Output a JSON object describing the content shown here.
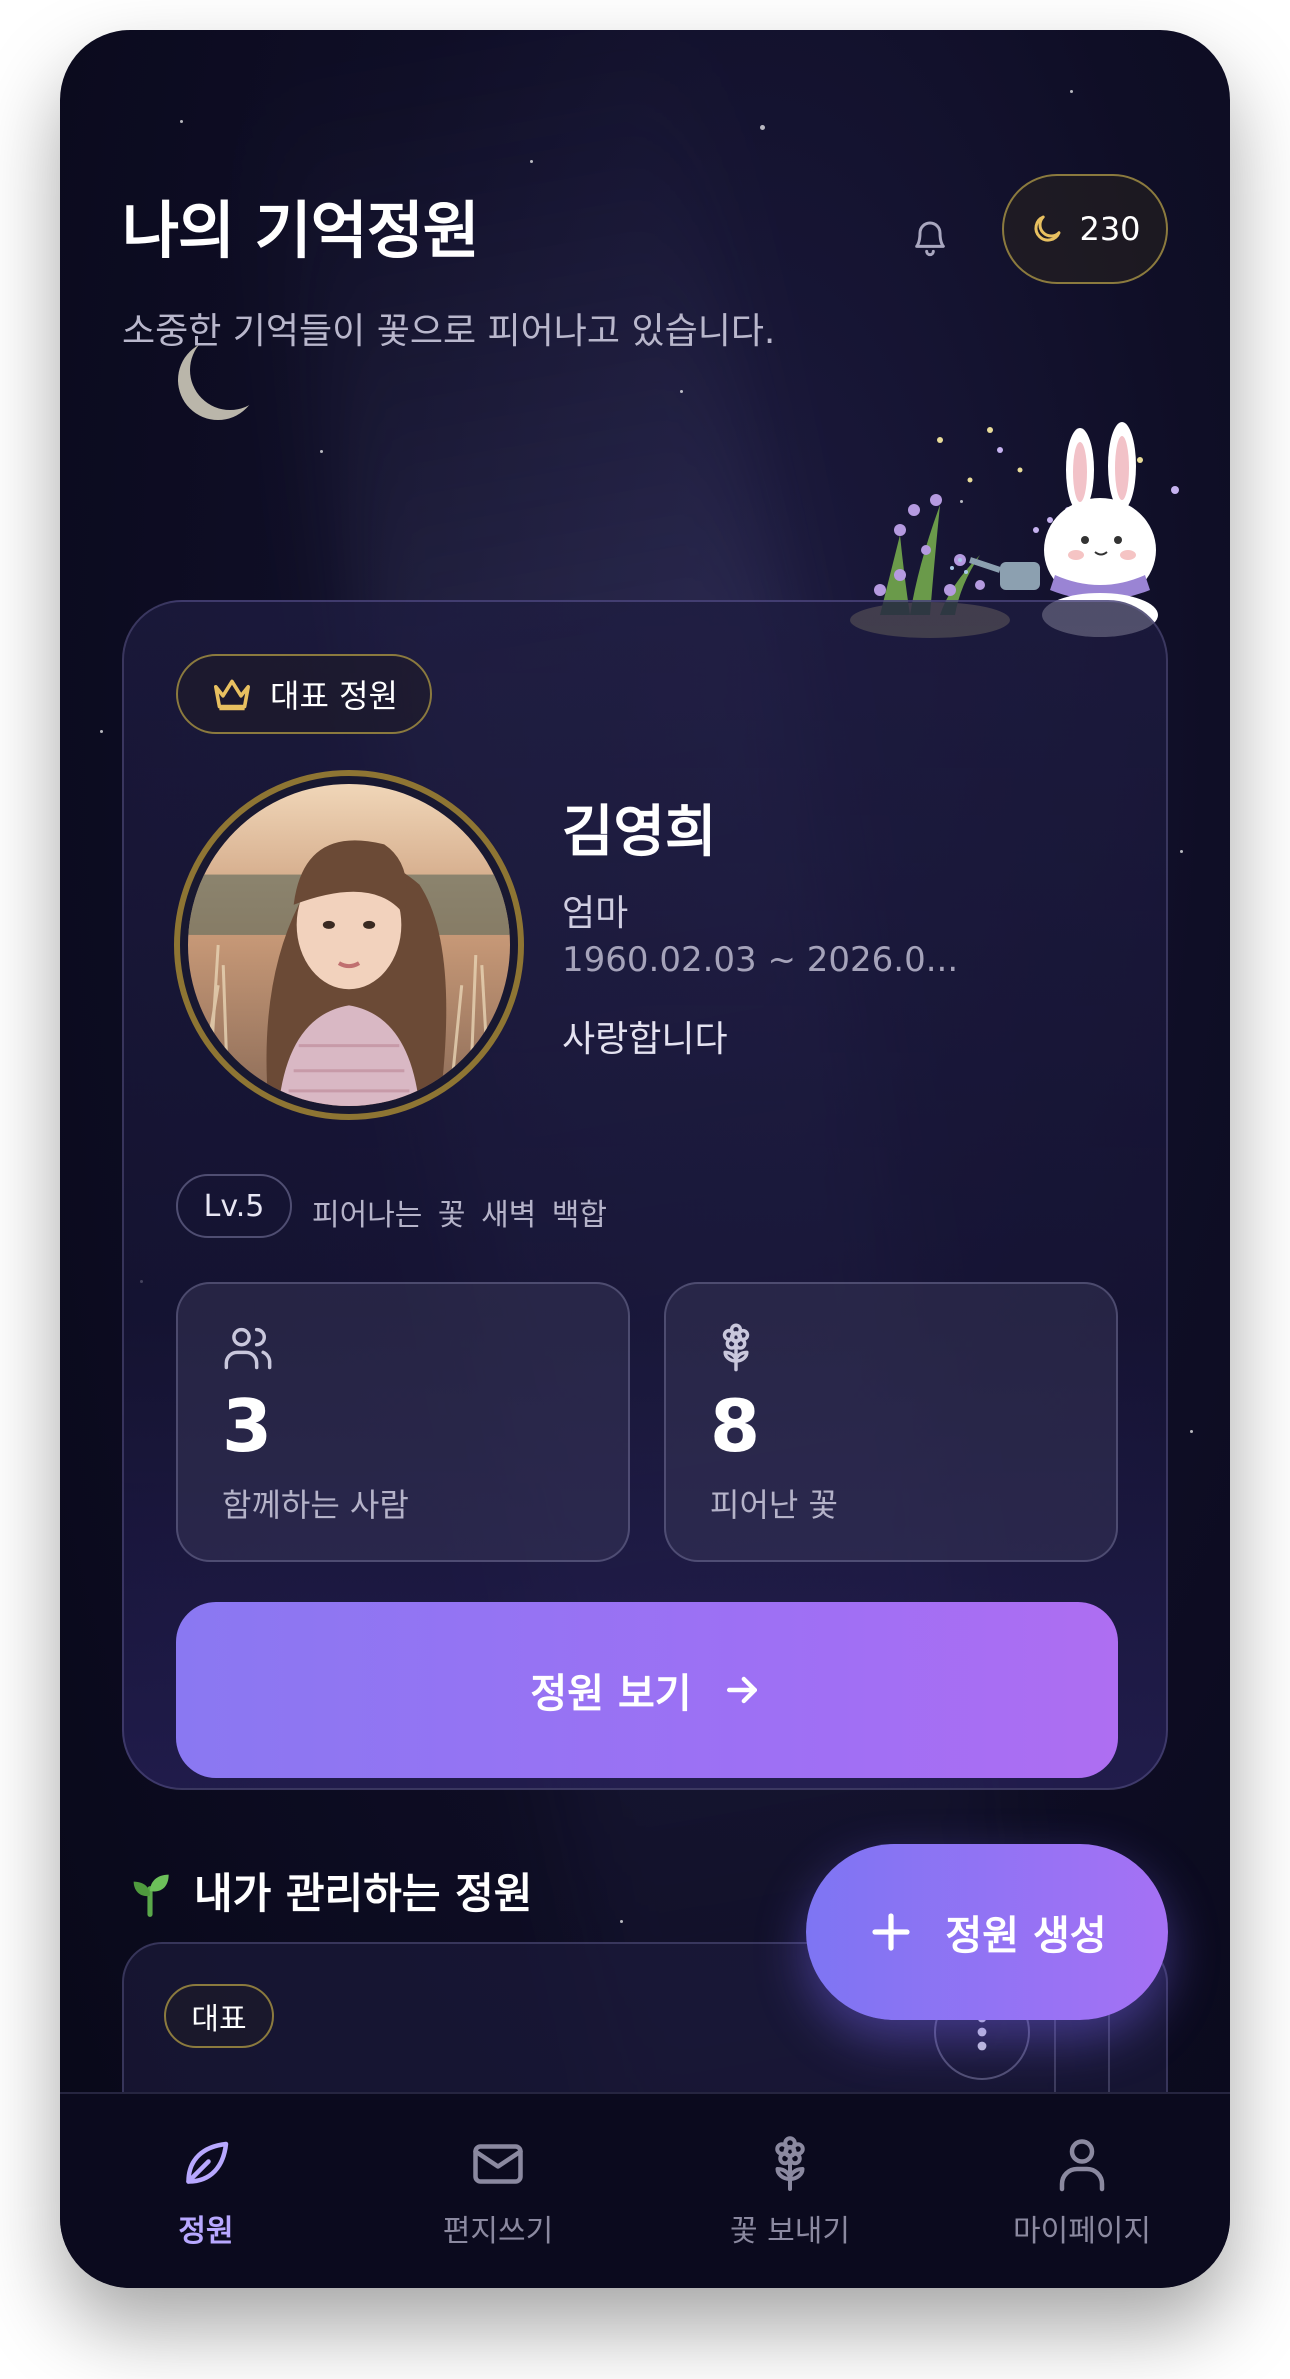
{
  "header": {
    "title": "나의 기억정원",
    "subtitle": "소중한 기억들이 꽃으로 피어나고 있습니다.",
    "coin_count": "230"
  },
  "main_card": {
    "badge": "대표 정원",
    "name": "김영희",
    "relation": "엄마",
    "dates": "1960.02.03 ~ 2026.0...",
    "message": "사랑합니다",
    "level": "Lv.5",
    "level_desc": "피어나는 꽃  새벽 백합",
    "stats": [
      {
        "value": "3",
        "label": "함께하는 사람",
        "icon": "people-icon"
      },
      {
        "value": "8",
        "label": "피어난 꽃",
        "icon": "flower-icon"
      }
    ],
    "view_button": "정원 보기"
  },
  "managed": {
    "title": "내가 관리하는 정원",
    "item_badge": "대표"
  },
  "fab": {
    "label": "정원 생성"
  },
  "nav": [
    {
      "label": "정원",
      "icon": "leaf-icon",
      "active": true
    },
    {
      "label": "편지쓰기",
      "icon": "mail-icon",
      "active": false
    },
    {
      "label": "꽃 보내기",
      "icon": "flower-icon",
      "active": false
    },
    {
      "label": "마이페이지",
      "icon": "person-icon",
      "active": false
    }
  ],
  "colors": {
    "accent_start": "#8a78f2",
    "accent_end": "#ae6ef2",
    "gold": "#e8c060",
    "background": "#0f0e26"
  }
}
